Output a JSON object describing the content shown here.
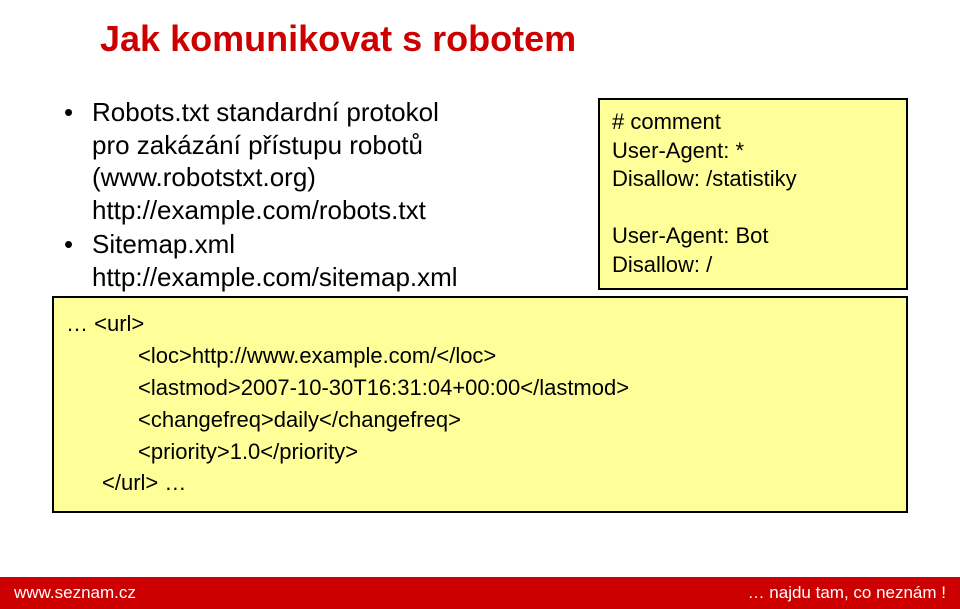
{
  "title": "Jak komunikovat s robotem",
  "bullets": [
    {
      "lines": [
        "Robots.txt standardní protokol",
        "pro zakázání přístupu robotů",
        "(www.robotstxt.org)",
        "http://example.com/robots.txt"
      ]
    },
    {
      "lines": [
        "Sitemap.xml",
        "http://example.com/sitemap.xml"
      ]
    }
  ],
  "robots_txt": {
    "line1": "# comment",
    "line2": "User-Agent: *",
    "line3": "Disallow: /statistiky",
    "line4": " ",
    "line5": "User-Agent: Bot",
    "line6": "Disallow: /"
  },
  "sitemap_xml": {
    "line1": "… <url>",
    "line2": "<loc>http://www.example.com/</loc>",
    "line3": "<lastmod>2007-10-30T16:31:04+00:00</lastmod>",
    "line4": "<changefreq>daily</changefreq>",
    "line5": "<priority>1.0</priority>",
    "line6": "</url> …"
  },
  "footer": {
    "left": "www.seznam.cz",
    "right": "… najdu tam, co neznám !"
  }
}
